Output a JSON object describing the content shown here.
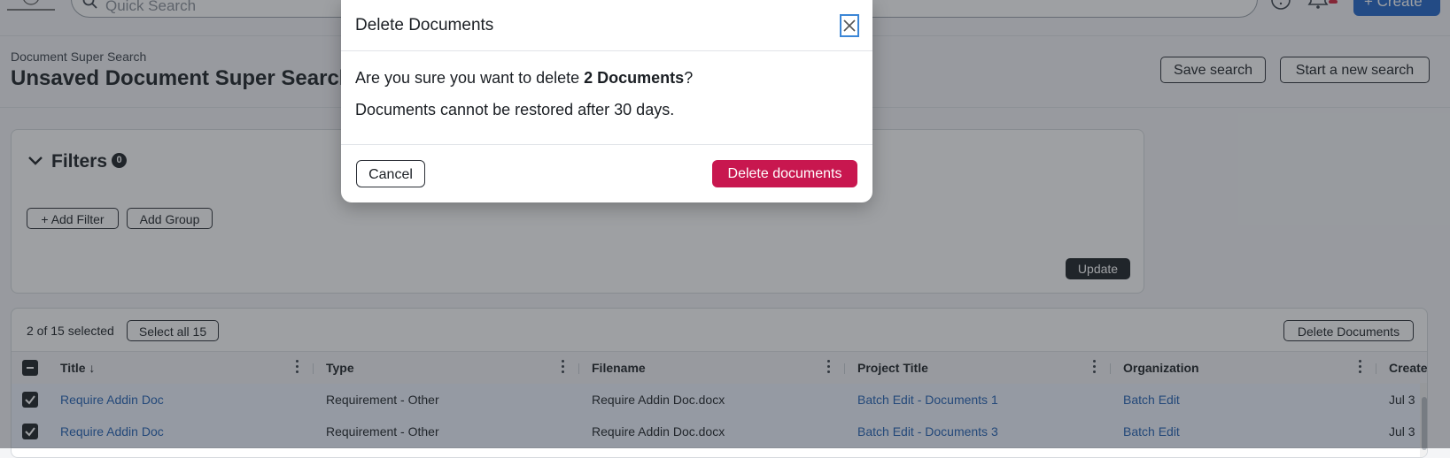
{
  "topbar": {
    "search_placeholder": "Quick Search",
    "create_label": "+ Create",
    "icons": [
      "help-icon",
      "bell-icon",
      "search-icon"
    ]
  },
  "header": {
    "breadcrumb": "Document Super Search",
    "title": "Unsaved Document Super Search",
    "save_search": "Save search",
    "new_search": "Start a new search"
  },
  "filters": {
    "label": "Filters",
    "count": "0",
    "add_filter": "Add Filter",
    "add_group": "Add Group",
    "update": "Update"
  },
  "results": {
    "selected_text": "2 of 15 selected",
    "select_all": "Select all 15",
    "delete_documents": "Delete Documents",
    "columns": [
      "Title",
      "Type",
      "Filename",
      "Project Title",
      "Organization",
      "Create"
    ],
    "rows": [
      {
        "title": "Require Addin Doc",
        "type": "Requirement - Other",
        "filename": "Require Addin Doc.docx",
        "project": "Batch Edit - Documents 1",
        "org": "Batch Edit",
        "created": "Jul 3"
      },
      {
        "title": "Require Addin Doc",
        "type": "Requirement - Other",
        "filename": "Require Addin Doc.docx",
        "project": "Batch Edit - Documents 3",
        "org": "Batch Edit",
        "created": "Jul 3"
      }
    ]
  },
  "modal": {
    "title": "Delete Documents",
    "question_prefix": "Are you sure you want to delete ",
    "question_bold": "2 Documents",
    "question_suffix": "?",
    "warning": "Documents cannot be restored after 30 days.",
    "cancel": "Cancel",
    "confirm": "Delete documents"
  },
  "colors": {
    "primary": "#1f64c8",
    "danger": "#c8174f",
    "link": "#1f5fb3",
    "dark": "#1b1f24"
  }
}
